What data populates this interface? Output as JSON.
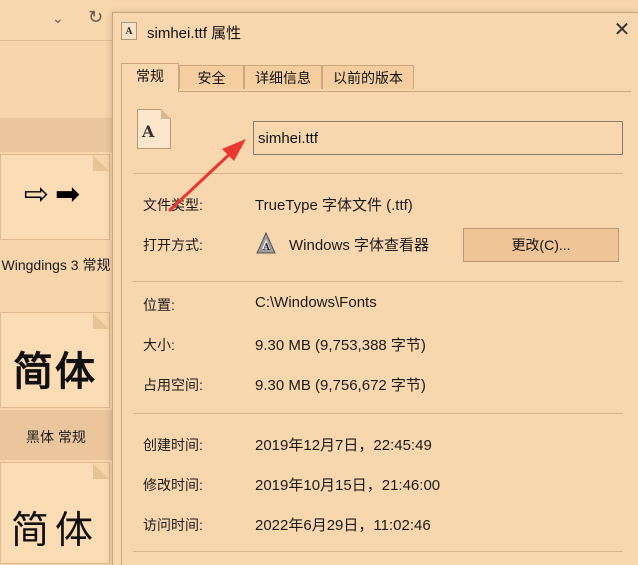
{
  "explorer": {
    "fonts": [
      {
        "preview": "⇨➡",
        "label": "Wingdings 3 常规"
      },
      {
        "preview": "简体",
        "label": "黑体 常规"
      },
      {
        "preview": "简体",
        "label": ""
      }
    ]
  },
  "dialog": {
    "title": "simhei.ttf 属性",
    "close_label": "✕",
    "file_icon_glyph": "A",
    "tabs": [
      {
        "label": "常规",
        "active": true
      },
      {
        "label": "安全",
        "active": false
      },
      {
        "label": "详细信息",
        "active": false
      },
      {
        "label": "以前的版本",
        "active": false
      }
    ],
    "filename": "simhei.ttf",
    "fields": {
      "type_label": "文件类型:",
      "type_value": "TrueType 字体文件 (.ttf)",
      "open_label": "打开方式:",
      "open_value": "Windows 字体查看器",
      "change_button": "更改(C)...",
      "location_label": "位置:",
      "location_value": "C:\\Windows\\Fonts",
      "size_label": "大小:",
      "size_value": "9.30 MB (9,753,388 字节)",
      "disk_label": "占用空间:",
      "disk_value": "9.30 MB (9,756,672 字节)",
      "created_label": "创建时间:",
      "created_value": "2019年12月7日，22:45:49",
      "modified_label": "修改时间:",
      "modified_value": "2019年10月15日，21:46:00",
      "accessed_label": "访问时间:",
      "accessed_value": "2022年6月29日，11:02:46"
    }
  },
  "colors": {
    "background": "#f8d5ab",
    "annotation_arrow": "#e8382f"
  },
  "icons": [
    "chevron-down-icon",
    "refresh-icon",
    "file-icon",
    "close-icon",
    "font-viewer-icon",
    "annotation-arrow"
  ]
}
